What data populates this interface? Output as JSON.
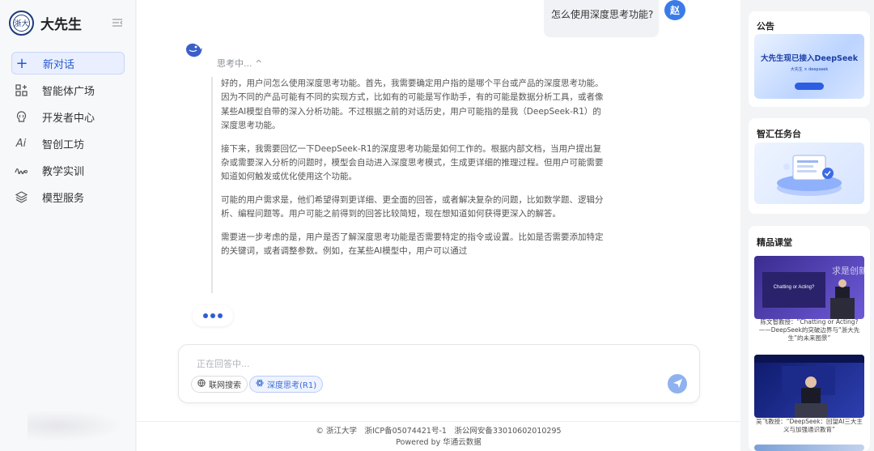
{
  "brand": {
    "name": "大先生",
    "logo_text": "浙大"
  },
  "nav": [
    {
      "label": "新对话",
      "icon": "plus-icon",
      "active": true
    },
    {
      "label": "智能体广场",
      "icon": "grid-plus-icon",
      "active": false
    },
    {
      "label": "开发者中心",
      "icon": "code-bulb-icon",
      "active": false
    },
    {
      "label": "智创工坊",
      "icon": "ai-icon",
      "active": false
    },
    {
      "label": "教学实训",
      "icon": "wave-icon",
      "active": false
    },
    {
      "label": "模型服务",
      "icon": "layers-icon",
      "active": false
    }
  ],
  "chat": {
    "user_message": "怎么使用深度思考功能?",
    "user_avatar": "赵",
    "thinking_label": "思考中... ^",
    "thinking_paragraphs": [
      "好的，用户问怎么使用深度思考功能。首先，我需要确定用户指的是哪个平台或产品的深度思考功能。因为不同的产品可能有不同的实现方式，比如有的可能是写作助手，有的可能是数据分析工具，或者像某些AI模型自带的深入分析功能。不过根据之前的对话历史，用户可能指的是我（DeepSeek-R1）的深度思考功能。",
      "接下来，我需要回忆一下DeepSeek-R1的深度思考功能是如何工作的。根据内部文档，当用户提出复杂或需要深入分析的问题时，模型会自动进入深度思考模式，生成更详细的推理过程。但用户可能需要知道如何触发或优化使用这个功能。",
      "可能的用户需求是，他们希望得到更详细、更全面的回答，或者解决复杂的问题，比如数学题、逻辑分析、编程问题等。用户可能之前得到的回答比较简短，现在想知道如何获得更深入的解答。",
      "需要进一步考虑的是，用户是否了解深度思考功能是否需要特定的指令或设置。比如是否需要添加特定的关键词，或者调整参数。例如，在某些AI模型中，用户可以通过"
    ]
  },
  "input": {
    "placeholder": "正在回答中...",
    "chip_web": "联网搜索",
    "chip_deep": "深度思考(R1)"
  },
  "footer": {
    "line1": "© 浙江大学　浙ICP备05074421号-1　浙公网安备33010602010295",
    "line2": "Powered by 华通云数据"
  },
  "rail": {
    "announcement_title": "公告",
    "announcement_banner": "大先生现已接入DeepSeek",
    "announcement_banner_sub": "大先生 × deepseek",
    "task_title": "智汇任务台",
    "course_title": "精品课堂",
    "courses": [
      {
        "caption": "陈文智教授：“Chatting or Acting?——DeepSeek的突破边界与“浙大先生”的未来图景”",
        "screen_text": "Chatting or Acting?",
        "banner_text": "求是创新"
      },
      {
        "caption": "吴飞教授：“DeepSeek：回望AI三大主义与加强通识教育”"
      }
    ]
  },
  "colors": {
    "accent": "#2f5bd6",
    "user_avatar": "#3a7be8",
    "send_button": "#8fb2ef"
  }
}
